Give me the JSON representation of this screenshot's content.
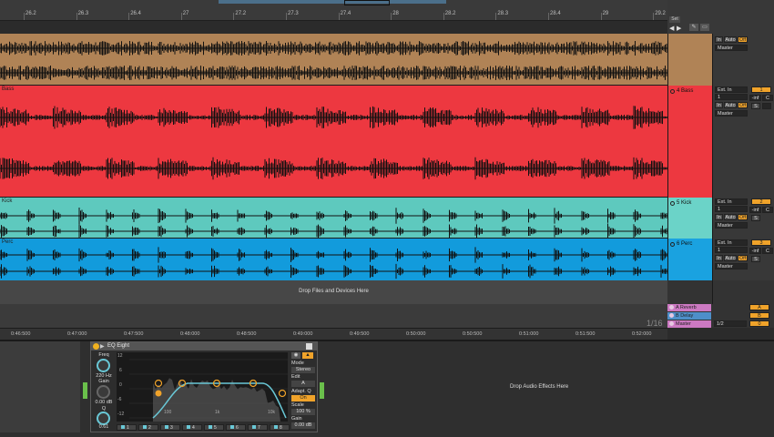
{
  "ruler": {
    "bars": [
      "26.2",
      "26.3",
      "26.4",
      "27",
      "27.2",
      "27.3",
      "27.4",
      "28",
      "28.2",
      "28.3",
      "28.4",
      "29",
      "29.2"
    ]
  },
  "header": {
    "set_label": "Set"
  },
  "tracks": [
    {
      "id": "track-1",
      "name": "",
      "color": "#b08356"
    },
    {
      "id": "track-4",
      "name": "4 Bass",
      "clip_name": "Bass",
      "color": "#ed3840"
    },
    {
      "id": "track-5",
      "name": "5 Kick",
      "clip_name": "Kick",
      "color": "#5ec9be"
    },
    {
      "id": "track-6",
      "name": "6 Perc",
      "clip_name": "Perc",
      "color": "#129bdc"
    }
  ],
  "io": {
    "in_label": "In",
    "auto_label": "Auto",
    "off_label": "Off",
    "master_label": "Master",
    "ext_in_label": "Ext. In",
    "channel_1": "1",
    "ch_1_label": "1",
    "ch_2_label": "2",
    "ch_3_label": "3",
    "vol_label": "0",
    "inf_label": "-inf",
    "c_label": "C",
    "s_label": "S",
    "a_label": "A",
    "b_label": "B"
  },
  "drop_files_text": "Drop Files and Devices Here",
  "returns": [
    {
      "name": "A Reverb",
      "color": "#cc79c2"
    },
    {
      "name": "B Delay",
      "color": "#4e8fc9"
    },
    {
      "name": "Master",
      "color": "#cc79c2"
    }
  ],
  "master_output": "1/2",
  "quantize_label": "1/16",
  "timeline": {
    "labels": [
      "0:46:500",
      "0:47:000",
      "0:47:500",
      "0:48:000",
      "0:48:500",
      "0:49:000",
      "0:49:500",
      "0:50:000",
      "0:50:500",
      "0:51:000",
      "0:51:500",
      "0:52:000"
    ]
  },
  "eq": {
    "title": "EQ Eight",
    "freq_label": "Freq",
    "freq_value": "220 Hz",
    "gain_label": "Gain",
    "gain_value": "0.00 dB",
    "q_label": "Q",
    "q_value": "0.61",
    "scale_ticks": [
      "12",
      "6",
      "0",
      "-6",
      "-12"
    ],
    "freq_ticks": [
      "100",
      "1k",
      "10k"
    ],
    "bands": [
      "1",
      "2",
      "3",
      "4",
      "5",
      "6",
      "7",
      "8"
    ],
    "mode_label": "Mode",
    "mode_value": "Stereo",
    "edit_label": "Edit",
    "edit_value": "A",
    "adapt_label": "Adapt. Q",
    "adapt_value": "On",
    "scale_label": "Scale",
    "scale_value": "100 %",
    "gain_out_label": "Gain",
    "gain_out_value": "0.00 dB"
  },
  "drop_fx_text": "Drop Audio Effects Here"
}
